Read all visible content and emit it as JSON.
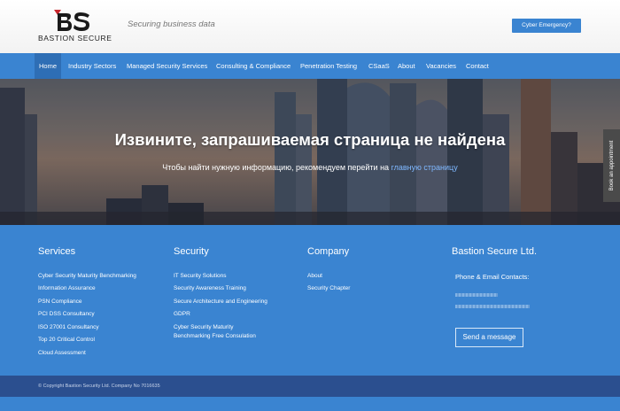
{
  "brand": {
    "logo_text": "BASTION SECURE",
    "tagline": "Securing business data"
  },
  "header": {
    "cta": "Cyber Emergency?"
  },
  "nav": {
    "items": [
      {
        "label": "Home",
        "active": true
      },
      {
        "label": "Industry Sectors"
      },
      {
        "label": "Managed Security Services"
      },
      {
        "label": "Consulting & Compliance"
      },
      {
        "label": "Penetration Testing"
      },
      {
        "label": "CSaaS"
      },
      {
        "label": "About"
      },
      {
        "label": "Vacancies"
      },
      {
        "label": "Contact"
      }
    ]
  },
  "hero": {
    "title": "Извините, запрашиваемая страница не найдена",
    "subtitle_prefix": "Чтобы найти нужную информацию, рекомендуем перейти на ",
    "subtitle_link": "главную страницу"
  },
  "side_tab": {
    "label": "Book an appointment"
  },
  "footer": {
    "services": {
      "title": "Services",
      "links": [
        "Cyber Security Maturity Benchmarking",
        "Information Assurance",
        "PSN Compliance",
        "PCI DSS Consultancy",
        "ISO 27001 Consultancy",
        "Top 20 Critical Control",
        "Cloud Assessment"
      ]
    },
    "security": {
      "title": "Security",
      "links": [
        "IT Security Solutions",
        "Security Awareness Training",
        "Secure Architecture and Engineering",
        "GDPR"
      ],
      "multi_line": [
        "Cyber Security Maturity",
        "Benchmarking Free Consulation"
      ]
    },
    "company": {
      "title": "Company",
      "links": [
        "About",
        "Security Chapter"
      ]
    },
    "bastion": {
      "title": "Bastion Secure Ltd.",
      "contacts_label": "Phone & Email Contacts:",
      "send_button": "Send a message"
    },
    "copyright": "© Copyright Bastion Security Ltd.     Company No 7016635"
  },
  "colors": {
    "primary": "#3a84d1",
    "nav_active": "#2e6eb5",
    "bottom_bar": "#2b4f8f",
    "link": "#7fb8ff"
  }
}
